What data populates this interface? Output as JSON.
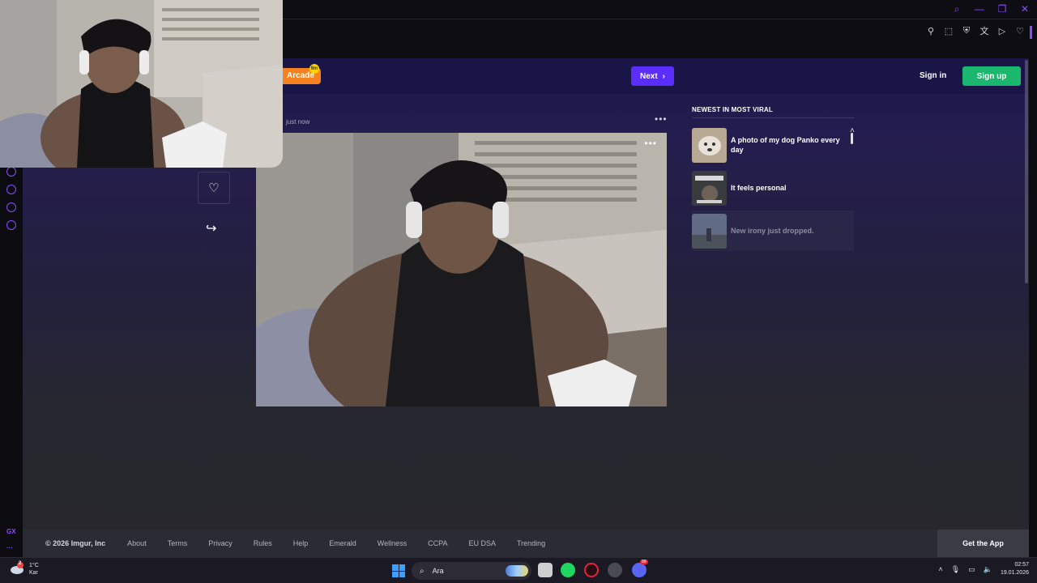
{
  "browser": {
    "window_controls": [
      "search-icon",
      "minimize-icon",
      "restore-icon",
      "close-icon"
    ],
    "toolbar_icons": [
      "pin-icon",
      "snapshot-icon",
      "shield-icon",
      "translate-icon",
      "play-icon",
      "heart-icon"
    ],
    "accent_color": "#8a4cff",
    "sidebar_label": "GX"
  },
  "imgur": {
    "nav": {
      "arcade_label": "Arcade",
      "arcade_badge": "9m",
      "next_label": "Next",
      "signin_label": "Sign in",
      "signup_label": "Sign up"
    },
    "post": {
      "timestamp": "just now",
      "menu_glyph": "•••"
    },
    "actions": {
      "favorite_glyph": "♡",
      "share_glyph": "↪"
    },
    "viral": {
      "heading": "NEWEST IN MOST VIRAL",
      "items": [
        {
          "title": "A photo of my dog Panko every day"
        },
        {
          "title": "It feels personal"
        },
        {
          "title": "New irony just dropped."
        }
      ]
    },
    "footer": {
      "copyright": "© 2026 Imgur, Inc",
      "links": [
        "About",
        "Terms",
        "Privacy",
        "Rules",
        "Help",
        "Emerald",
        "Wellness",
        "CCPA",
        "EU DSA",
        "Trending"
      ],
      "get_app": "Get the App"
    }
  },
  "taskbar": {
    "weather_temp": "1°C",
    "weather_desc": "Kar",
    "weather_badge": "2",
    "search_placeholder": "Ara",
    "discord_badge": "99",
    "time": "02:57",
    "date": "19.01.2026"
  }
}
